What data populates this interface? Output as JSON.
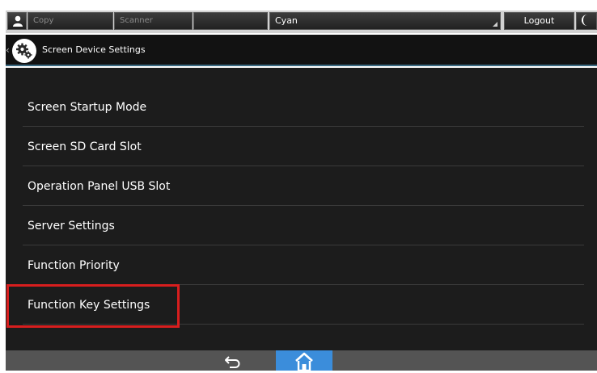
{
  "topbar": {
    "user_icon": "person-icon",
    "copy_label": "Copy",
    "scanner_label": "Scanner",
    "search_value": "Cyan",
    "logout_label": "Logout",
    "moon_icon": "moon-icon"
  },
  "titlebar": {
    "back_glyph": "‹",
    "icon": "gear-icon",
    "title": "Screen Device Settings"
  },
  "menu": {
    "items": [
      {
        "label": "Screen Startup Mode"
      },
      {
        "label": "Screen SD Card Slot"
      },
      {
        "label": "Operation Panel USB Slot"
      },
      {
        "label": "Server Settings"
      },
      {
        "label": "Function Priority"
      },
      {
        "label": "Function Key Settings",
        "highlighted": true
      }
    ]
  },
  "bottombar": {
    "back_icon": "return-arrow-icon",
    "home_icon": "home-icon"
  },
  "colors": {
    "background": "#1c1c1c",
    "highlight": "#d81e1e",
    "home_button": "#3b8ddb",
    "title_underline": "#3a6a82"
  }
}
